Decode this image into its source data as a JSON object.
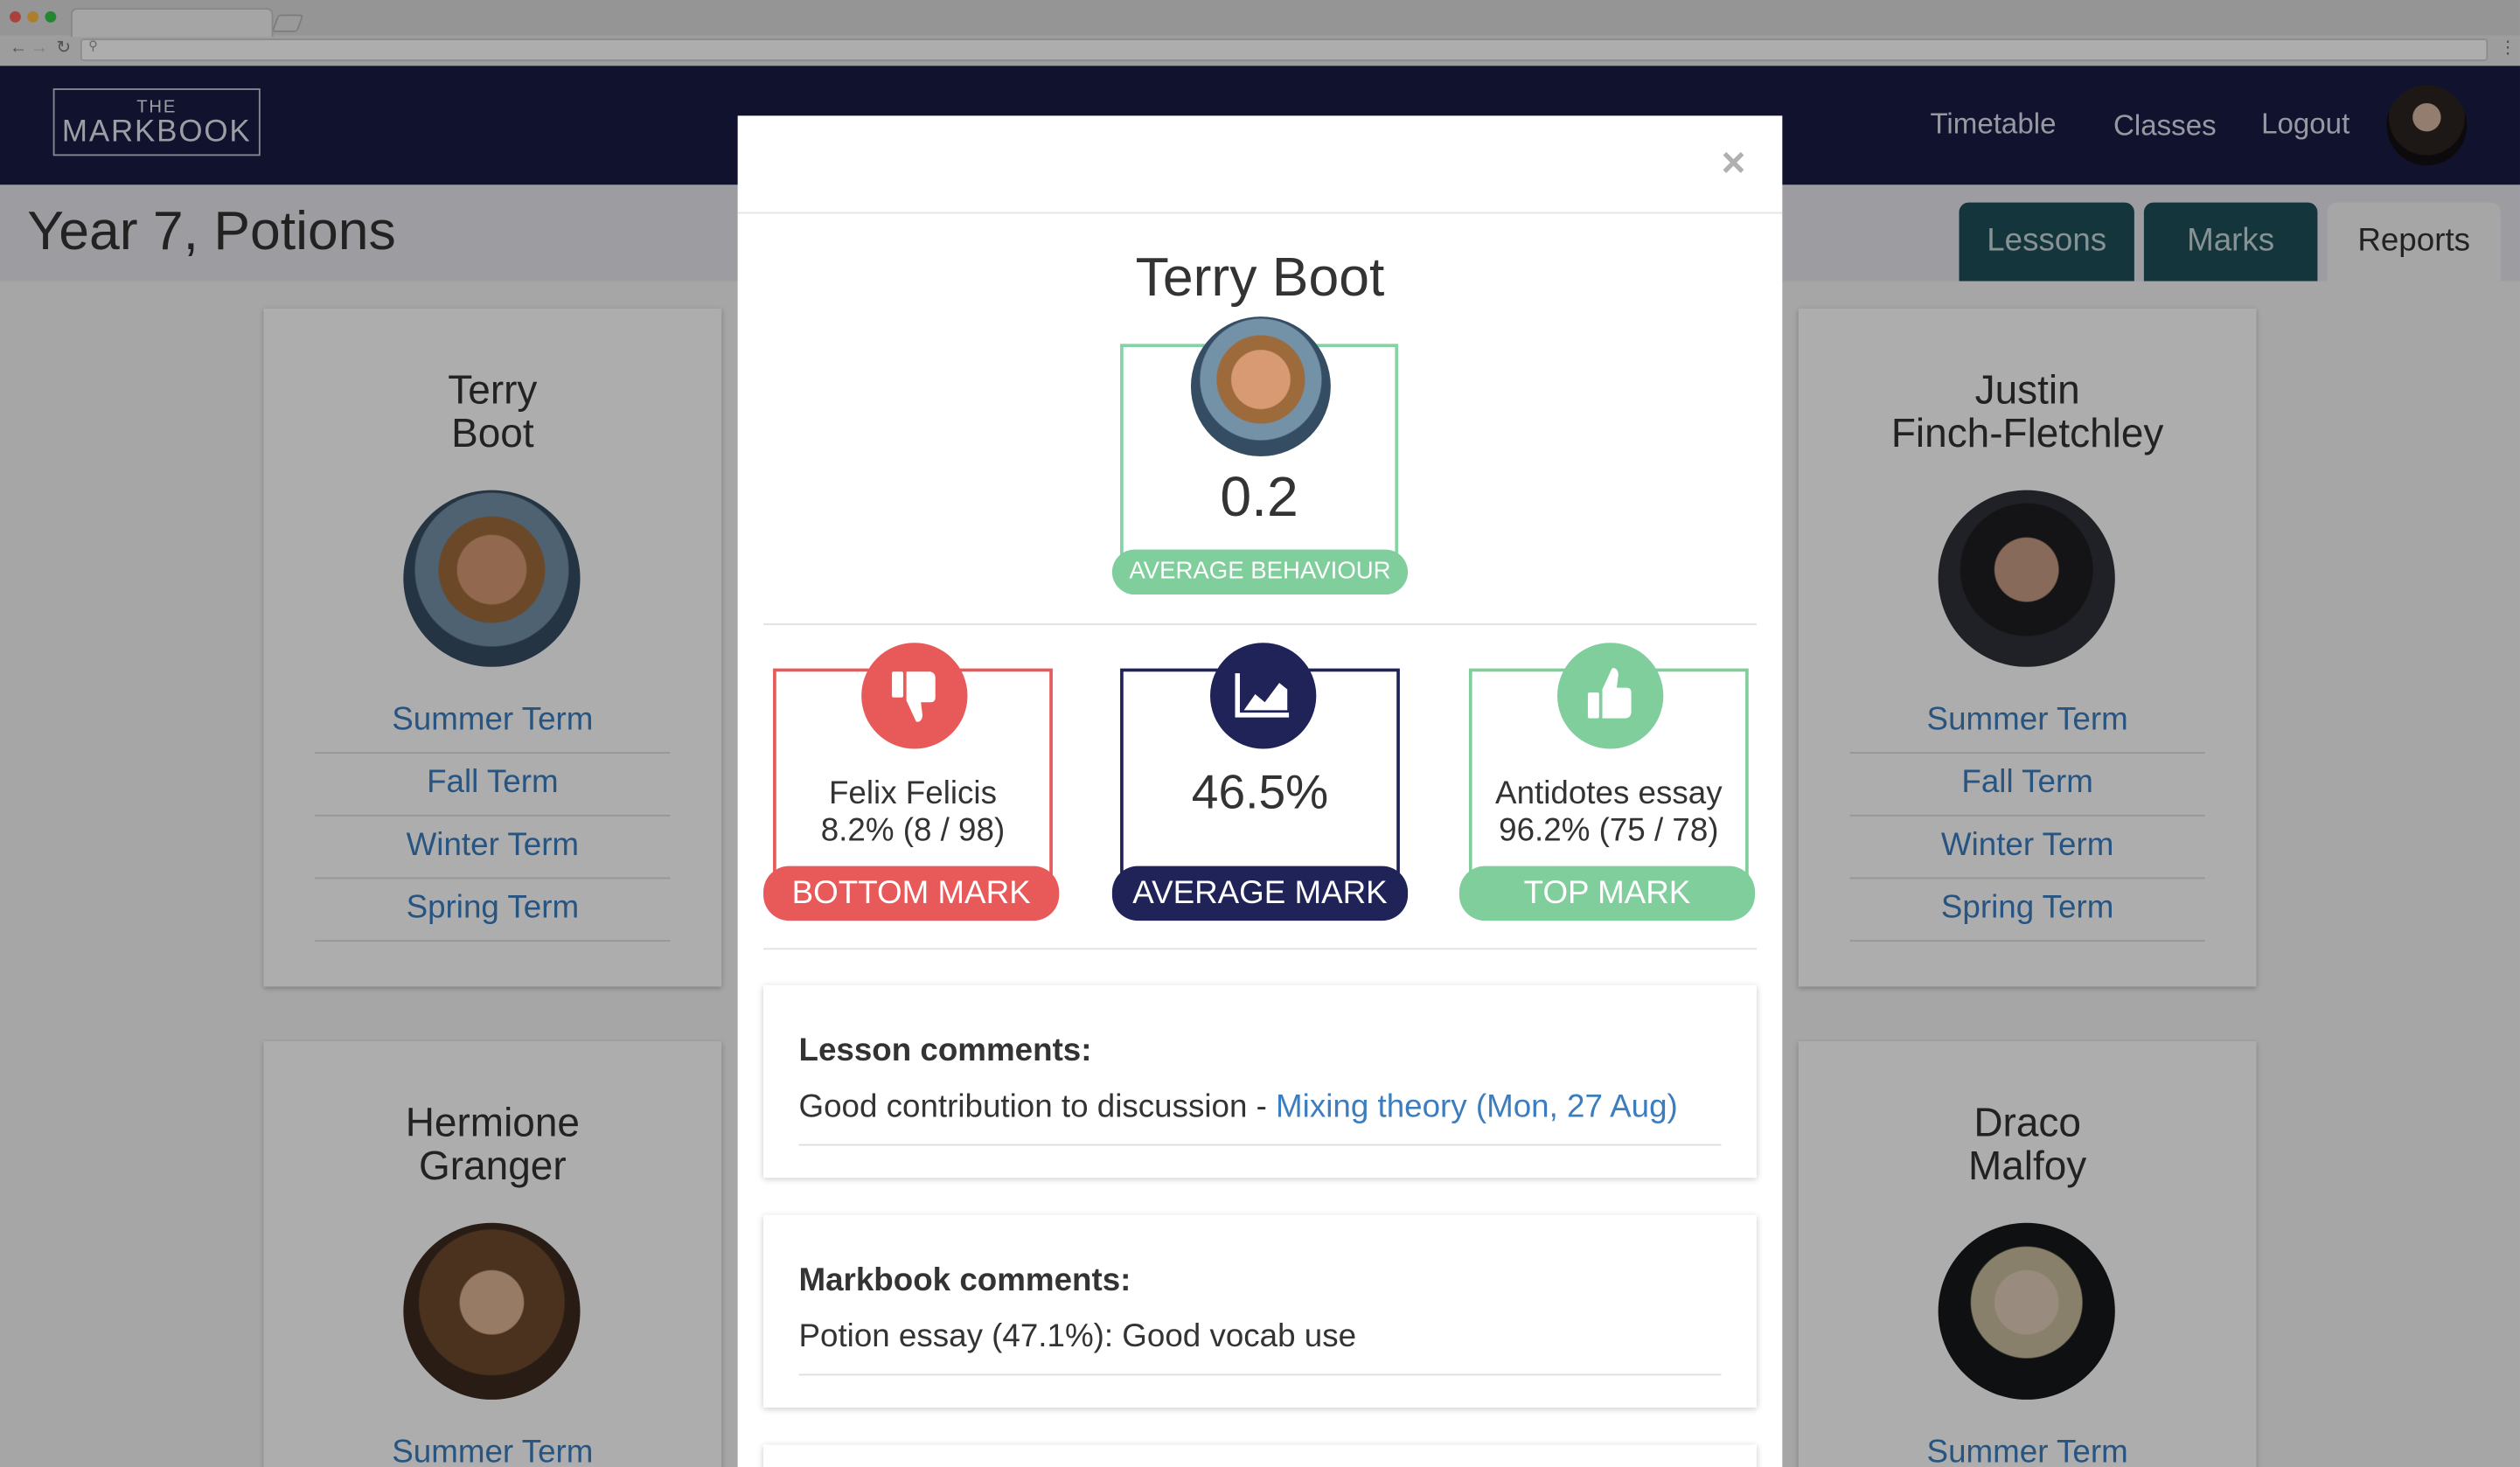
{
  "header": {
    "logo_top": "THE",
    "logo_main": "MARKBOOK",
    "nav": [
      "Timetable",
      "Classes",
      "Logout"
    ]
  },
  "page": {
    "title": "Year 7, Potions",
    "tabs": [
      "Lessons",
      "Marks",
      "Reports"
    ],
    "active_tab": "Reports"
  },
  "students": [
    {
      "first": "Terry",
      "last": "Boot",
      "terms": [
        "Summer Term",
        "Fall Term",
        "Winter Term",
        "Spring Term"
      ]
    },
    {
      "first": "Justin",
      "last": "Finch-Fletchley",
      "terms": [
        "Summer Term",
        "Fall Term",
        "Winter Term",
        "Spring Term"
      ]
    },
    {
      "first": "Hermione",
      "last": "Granger",
      "terms": [
        "Summer Term"
      ]
    },
    {
      "first": "Draco",
      "last": "Malfoy",
      "terms": [
        "Summer Term"
      ]
    }
  ],
  "modal": {
    "close_glyph": "×",
    "student_name": "Terry Boot",
    "behaviour_value": "0.2",
    "behaviour_label": "AVERAGE BEHAVIOUR",
    "bottom_mark": {
      "assignment": "Felix Felicis",
      "score": "8.2% (8 / 98)",
      "label": "BOTTOM MARK"
    },
    "average_mark": {
      "value": "46.5%",
      "label": "AVERAGE MARK"
    },
    "top_mark": {
      "assignment": "Antidotes essay",
      "score": "96.2% (75 / 78)",
      "label": "TOP MARK"
    },
    "lesson_comments": {
      "title": "Lesson comments:",
      "text": "Good contribution to discussion - ",
      "link": "Mixing theory (Mon, 27 Aug)"
    },
    "markbook_comments": {
      "title": "Markbook comments:",
      "text": "Potion essay (47.1%): Good vocab use"
    }
  },
  "colors": {
    "header_bg": "#181b44",
    "tab_dark": "#1c4e58",
    "link": "#3b7dbf",
    "bottom_red": "#e8595a",
    "average_navy": "#1f2358",
    "top_green": "#7fce9c"
  },
  "icons": [
    "search-icon",
    "thumbs-down-icon",
    "chart-area-icon",
    "thumbs-up-icon",
    "close-icon"
  ]
}
